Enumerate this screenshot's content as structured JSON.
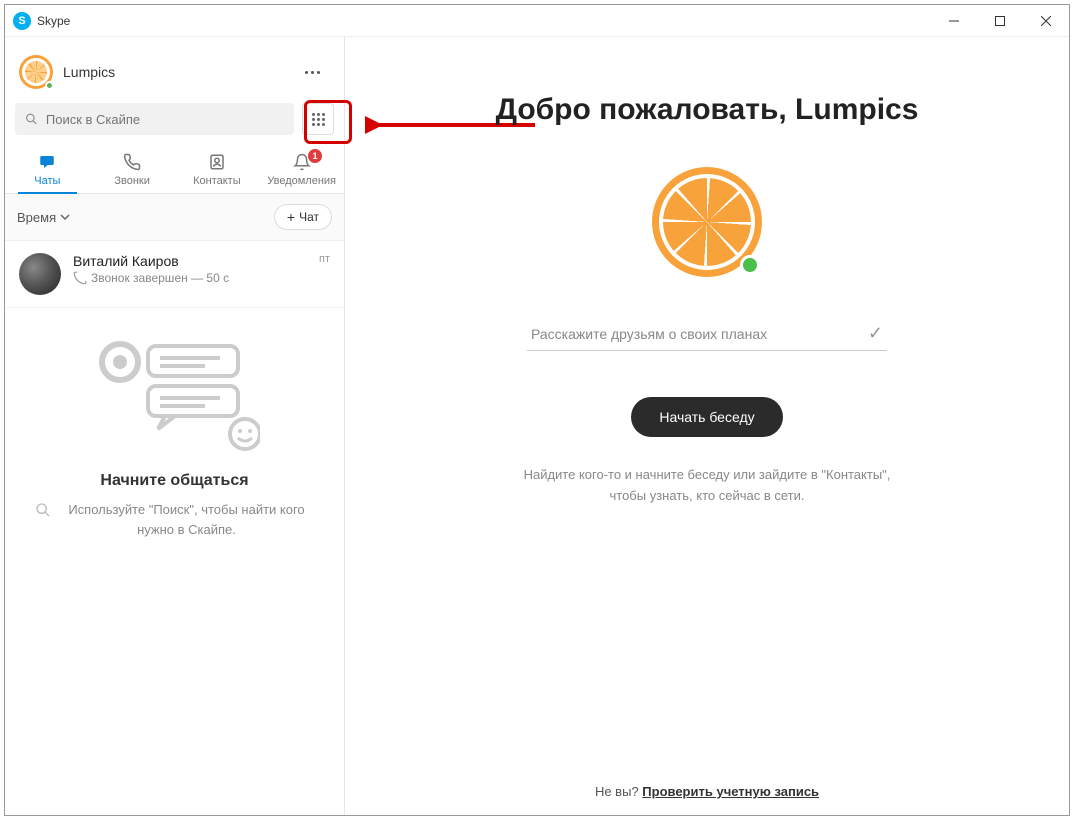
{
  "window": {
    "title": "Skype"
  },
  "profile": {
    "name": "Lumpics"
  },
  "search": {
    "placeholder": "Поиск в Скайпе"
  },
  "tabs": {
    "chats": "Чаты",
    "calls": "Звонки",
    "contacts": "Контакты",
    "notifications": "Уведомления",
    "badge": "1"
  },
  "filter": {
    "label": "Время",
    "new_chat": "Чат"
  },
  "chat_list": [
    {
      "name": "Виталий  Каиров",
      "subtitle": "Звонок завершен — 50 с",
      "time": "пт"
    }
  ],
  "empty": {
    "title": "Начните общаться",
    "text": "Используйте \"Поиск\", чтобы найти кого нужно в Скайпе."
  },
  "main": {
    "welcome": "Добро пожаловать, Lumpics",
    "status_placeholder": "Расскажите друзьям о своих планах",
    "start_button": "Начать беседу",
    "help_text": "Найдите кого-то и начните беседу или зайдите в \"Контакты\", чтобы узнать, кто сейчас в сети.",
    "footer_question": "Не вы?",
    "footer_link": "Проверить учетную запись"
  }
}
